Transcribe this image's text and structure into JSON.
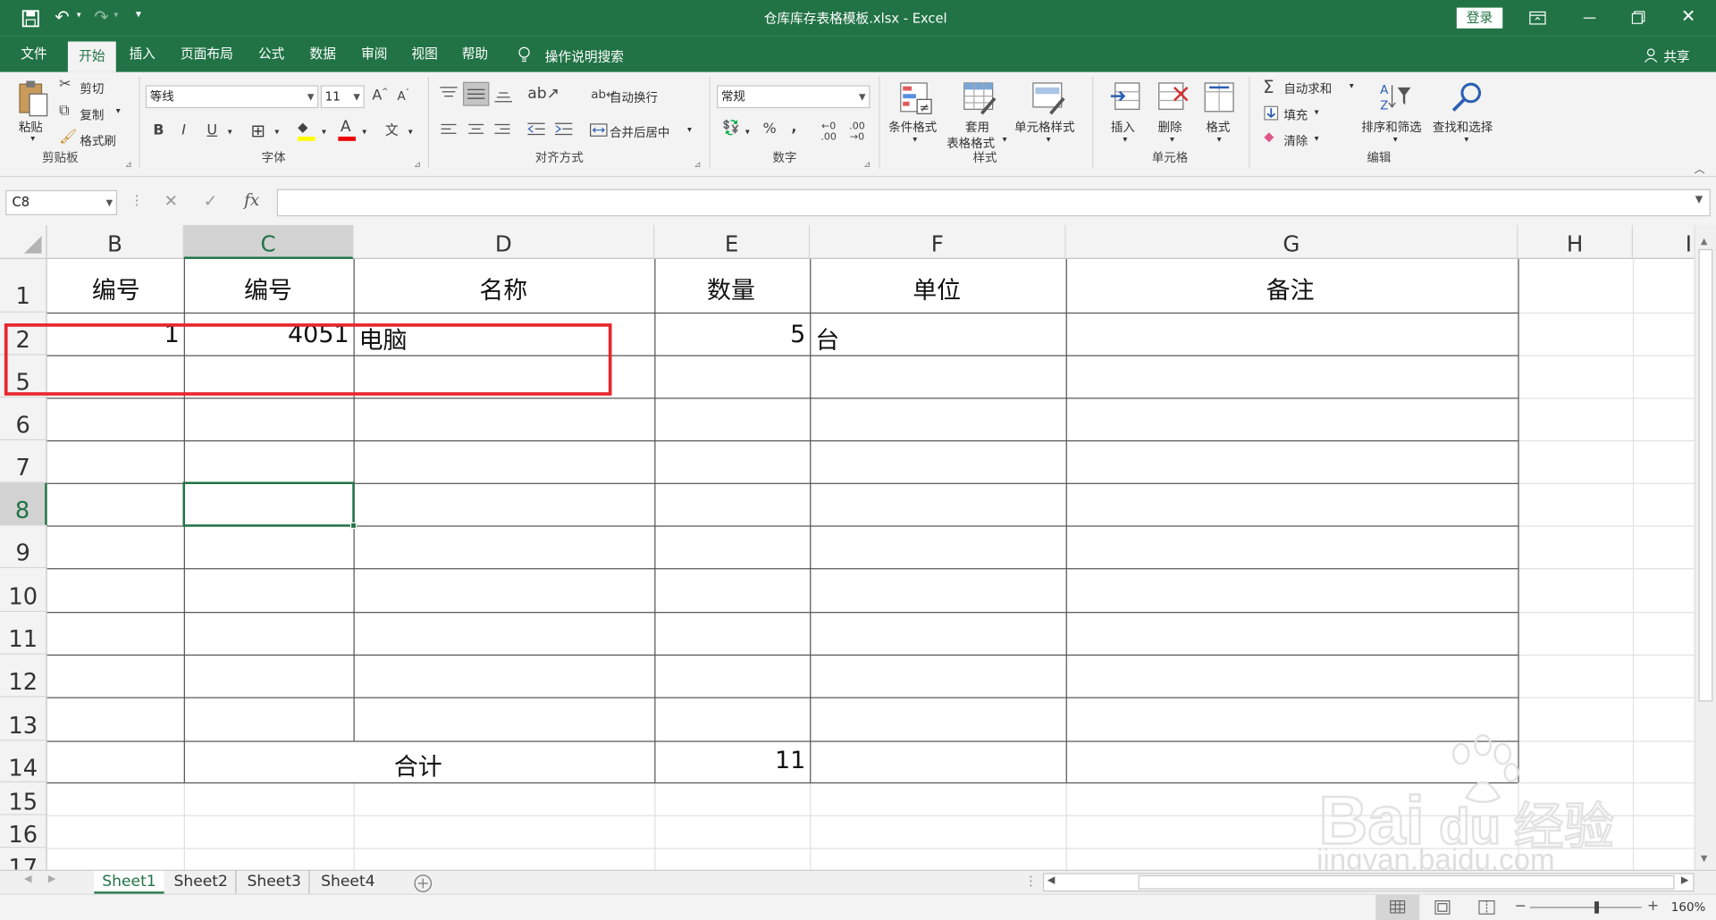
{
  "titlebar": {
    "title": "仓库库存表格模板.xlsx  -  Excel",
    "login": "登录"
  },
  "menu": {
    "tabs": [
      {
        "label": "文件"
      },
      {
        "label": "开始"
      },
      {
        "label": "插入"
      },
      {
        "label": "页面布局"
      },
      {
        "label": "公式"
      },
      {
        "label": "数据"
      },
      {
        "label": "审阅"
      },
      {
        "label": "视图"
      },
      {
        "label": "帮助"
      }
    ],
    "tellme": "操作说明搜索",
    "share": "共享"
  },
  "ribbon": {
    "clipboard": {
      "paste": "粘贴",
      "cut": "剪切",
      "copy": "复制",
      "format_painter": "格式刷",
      "group": "剪贴板"
    },
    "font": {
      "name": "等线",
      "size": "11",
      "group": "字体"
    },
    "alignment": {
      "wrap": "自动换行",
      "merge": "合并后居中",
      "group": "对齐方式"
    },
    "number": {
      "format": "常规",
      "group": "数字"
    },
    "styles": {
      "conditional": "条件格式",
      "table1": "套用",
      "table2": "表格格式",
      "cell_styles": "单元格样式",
      "group": "样式"
    },
    "cells": {
      "insert": "插入",
      "delete": "删除",
      "format": "格式",
      "group": "单元格"
    },
    "editing": {
      "autosum": "自动求和",
      "fill": "填充",
      "clear": "清除",
      "sort": "排序和筛选",
      "find": "查找和选择",
      "group": "编辑"
    }
  },
  "formula_bar": {
    "name_box": "C8",
    "fx": "fx",
    "formula": ""
  },
  "columns": [
    "B",
    "C",
    "D",
    "E",
    "F",
    "G",
    "H",
    "I"
  ],
  "rows": [
    "1",
    "2",
    "5",
    "6",
    "7",
    "8",
    "9",
    "10",
    "11",
    "12",
    "13",
    "14",
    "15",
    "16",
    "17"
  ],
  "cells": {
    "b1": "编号",
    "c1": "编号",
    "d1": "名称",
    "e1": "数量",
    "f1": "单位",
    "g1": "备注",
    "b2": "1",
    "c2": "4051",
    "d2": "电脑",
    "e2": "5",
    "f2": "台",
    "cd14": "合计",
    "e14": "11"
  },
  "sheets": [
    "Sheet1",
    "Sheet2",
    "Sheet3",
    "Sheet4"
  ],
  "status": {
    "zoom": "160%"
  },
  "watermark": {
    "logo": "Baidu经验",
    "url": "jingyan.baidu.com"
  },
  "colors": {
    "excel_green": "#217346",
    "highlight_box": "#e8262c"
  }
}
